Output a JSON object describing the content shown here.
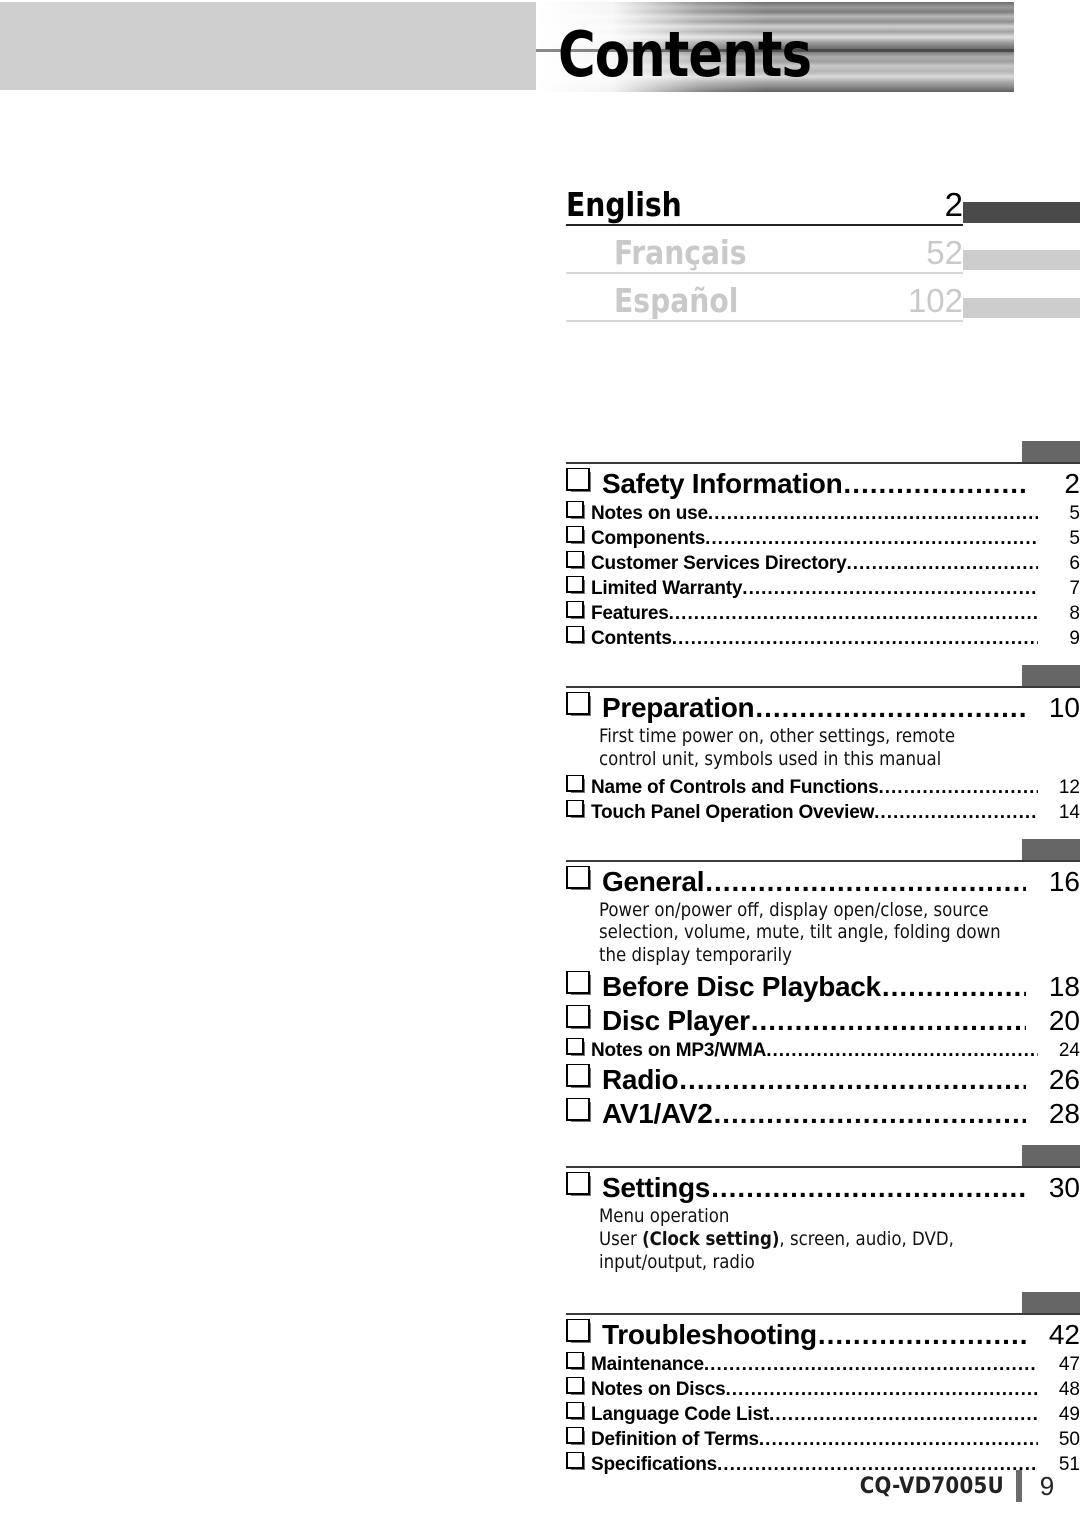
{
  "header": {
    "title": "Contents",
    "photo_alt": "seascape-photo-band"
  },
  "languages": [
    {
      "name": "English",
      "page": "2",
      "active": true
    },
    {
      "name": "Français",
      "page": "52",
      "active": false
    },
    {
      "name": "Español",
      "page": "102",
      "active": false
    }
  ],
  "colors": {
    "active_tab": "#4a4a4a",
    "inactive_tab": "#cccccc",
    "section_tab": "#666666",
    "header_band": "#cfcfcf",
    "muted_text": "#c9c9c9"
  },
  "toc": {
    "sections": [
      {
        "entries": [
          {
            "kind": "main",
            "label": "Safety Information",
            "page": "2"
          },
          {
            "kind": "sub",
            "label": "Notes on use",
            "page": "5"
          },
          {
            "kind": "sub",
            "label": "Components",
            "page": "5"
          },
          {
            "kind": "sub",
            "label": "Customer Services Directory",
            "page": "6"
          },
          {
            "kind": "sub",
            "label": "Limited Warranty",
            "page": "7"
          },
          {
            "kind": "sub",
            "label": "Features",
            "page": "8"
          },
          {
            "kind": "sub",
            "label": "Contents",
            "page": "9"
          }
        ]
      },
      {
        "entries": [
          {
            "kind": "main",
            "label": "Preparation",
            "page": "10",
            "desc": "First time power on, other settings, remote control unit, symbols used in this manual"
          },
          {
            "kind": "sub",
            "label": "Name of Controls and Functions",
            "page": "12"
          },
          {
            "kind": "sub",
            "label": "Touch Panel Operation Oveview",
            "page": "14"
          }
        ]
      },
      {
        "entries": [
          {
            "kind": "main",
            "label": "General",
            "page": "16",
            "desc": "Power on/power off, display open/close, source selection, volume, mute, tilt angle, folding down the display temporarily"
          },
          {
            "kind": "main",
            "label": "Before Disc Playback",
            "page": "18"
          },
          {
            "kind": "main",
            "label": "Disc Player",
            "page": "20"
          },
          {
            "kind": "sub",
            "label": "Notes on MP3/WMA",
            "page": "24"
          },
          {
            "kind": "main",
            "label": "Radio",
            "page": "26"
          },
          {
            "kind": "main",
            "label": "AV1/AV2",
            "page": "28"
          }
        ]
      },
      {
        "entries": [
          {
            "kind": "main",
            "label": "Settings",
            "page": "30",
            "desc_line1": "Menu operation",
            "desc_pre": "User ",
            "desc_bold": "(Clock setting)",
            "desc_post": ", screen, audio, DVD, input/output, radio"
          }
        ]
      },
      {
        "entries": [
          {
            "kind": "main",
            "label": "Troubleshooting",
            "page": "42"
          },
          {
            "kind": "sub",
            "label": "Maintenance",
            "page": "47"
          },
          {
            "kind": "sub",
            "label": "Notes on Discs",
            "page": "48"
          },
          {
            "kind": "sub",
            "label": "Language Code List",
            "page": "49"
          },
          {
            "kind": "sub",
            "label": "Definition of Terms",
            "page": "50"
          },
          {
            "kind": "sub",
            "label": "Specifications",
            "page": "51"
          }
        ]
      }
    ]
  },
  "footer": {
    "model": "CQ-VD7005U",
    "page_number": "9"
  }
}
